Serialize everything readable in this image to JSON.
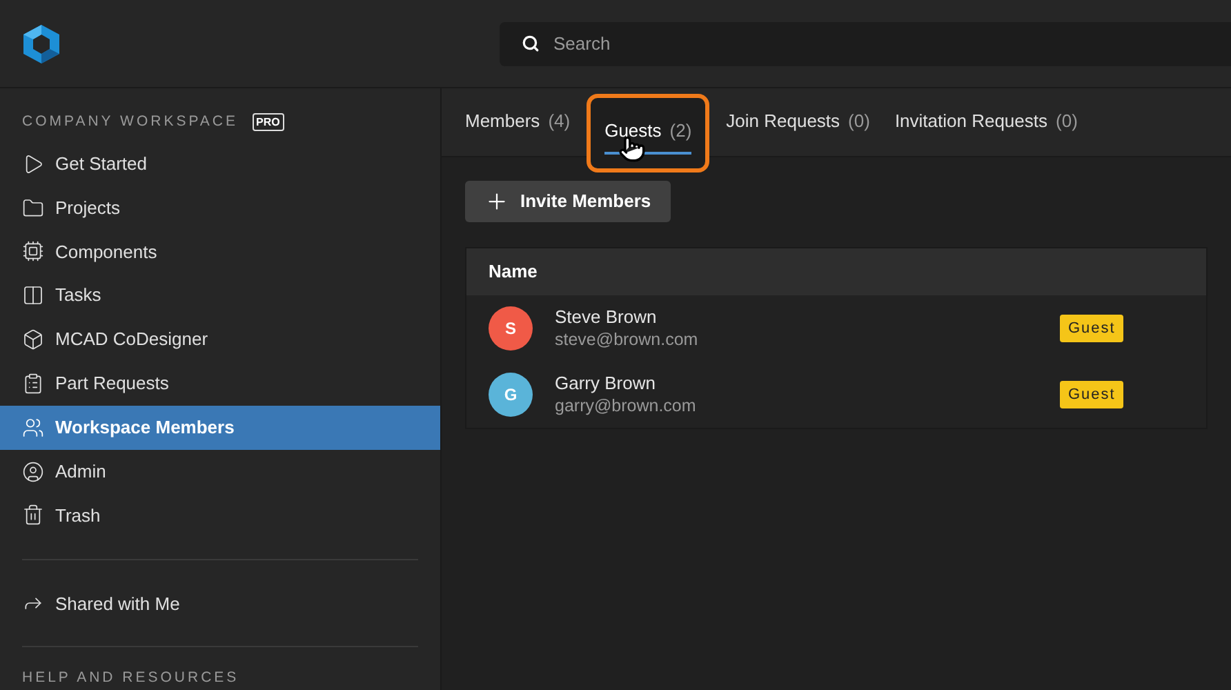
{
  "search": {
    "placeholder": "Search"
  },
  "sidebar": {
    "section_title": "COMPANY WORKSPACE",
    "plan_badge": "PRO",
    "items": [
      {
        "label": "Get Started",
        "selected": false
      },
      {
        "label": "Projects",
        "selected": false
      },
      {
        "label": "Components",
        "selected": false
      },
      {
        "label": "Tasks",
        "selected": false
      },
      {
        "label": "MCAD CoDesigner",
        "selected": false
      },
      {
        "label": "Part Requests",
        "selected": false
      },
      {
        "label": "Workspace Members",
        "selected": true
      },
      {
        "label": "Admin",
        "selected": false
      },
      {
        "label": "Trash",
        "selected": false
      }
    ],
    "shared_item": {
      "label": "Shared with Me"
    },
    "footer_title": "HELP AND RESOURCES"
  },
  "tabs": [
    {
      "label": "Members",
      "count": "(4)",
      "selected": false,
      "highlighted": false
    },
    {
      "label": "Guests",
      "count": "(2)",
      "selected": true,
      "highlighted": true
    },
    {
      "label": "Join Requests",
      "count": "(0)",
      "selected": false,
      "highlighted": false
    },
    {
      "label": "Invitation Requests",
      "count": "(0)",
      "selected": false,
      "highlighted": false
    }
  ],
  "invite_button": "Invite Members",
  "table": {
    "columns": [
      "Name"
    ],
    "rows": [
      {
        "initial": "S",
        "color": "#f05a47",
        "name": "Steve Brown",
        "email": "steve@brown.com",
        "role": "Guest"
      },
      {
        "initial": "G",
        "color": "#5ab4d9",
        "name": "Garry Brown",
        "email": "garry@brown.com",
        "role": "Guest"
      }
    ]
  }
}
